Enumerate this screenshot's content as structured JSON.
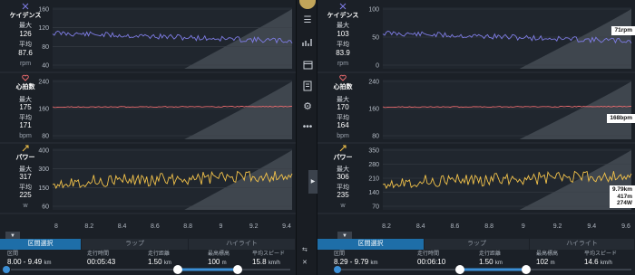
{
  "metrics": {
    "cadence": "ケイデンス",
    "heart_rate": "心拍数",
    "power": "パワー"
  },
  "stat_labels": {
    "max": "最大",
    "avg": "平均"
  },
  "units": {
    "rpm": "rpm",
    "bpm": "bpm",
    "w": "w"
  },
  "icons": {
    "cadence": "cadence-icon",
    "heart": "heart-icon",
    "power": "power-icon",
    "menu": "menu-icon",
    "graph": "graph-icon",
    "calendar": "calendar-icon",
    "file": "file-icon",
    "settings": "settings-icon",
    "more": "more-icon"
  },
  "colors": {
    "cadence": "#7f7de6",
    "heart": "#e86a6d",
    "power": "#f2c24a",
    "accent": "#1e6ea8",
    "track": "#3b8fd6"
  },
  "left": {
    "cadence": {
      "max": "126",
      "avg": "87.6",
      "ticks": [
        "160",
        "120",
        "80",
        "40"
      ]
    },
    "heart": {
      "max": "175",
      "avg": "171",
      "ticks": [
        "240",
        "160",
        "80"
      ]
    },
    "power": {
      "max": "317",
      "avg": "225",
      "ticks": [
        "400",
        "300",
        "150",
        "60"
      ]
    },
    "x_ticks": [
      "8",
      "8.2",
      "8.4",
      "8.6",
      "8.8",
      "9",
      "9.2",
      "9.4"
    ],
    "tabs": [
      "区間選択",
      "ラップ",
      "ハイライト"
    ],
    "stats": [
      {
        "label": "区間",
        "value": "8.00 - 9.49",
        "unit": "km"
      },
      {
        "label": "走行時間",
        "value": "00:05:43",
        "unit": ""
      },
      {
        "label": "走行距離",
        "value": "1.50",
        "unit": "km"
      },
      {
        "label": "最高標高",
        "value": "100",
        "unit": "m"
      },
      {
        "label": "平均スピード",
        "value": "15.8",
        "unit": "km/h"
      }
    ]
  },
  "right": {
    "cadence": {
      "max": "103",
      "avg": "83.9",
      "ticks": [
        "100",
        "50",
        "0"
      ],
      "tooltip": "71rpm"
    },
    "heart": {
      "max": "170",
      "avg": "164",
      "ticks": [
        "240",
        "160",
        "80"
      ],
      "tooltip": "168bpm"
    },
    "power": {
      "max": "306",
      "avg": "235",
      "ticks": [
        "350",
        "280",
        "210",
        "140",
        "70"
      ],
      "tooltip": [
        "9.79km",
        "417m",
        "274W"
      ]
    },
    "x_ticks": [
      "8.2",
      "8.4",
      "8.6",
      "8.8",
      "9",
      "9.2",
      "9.4",
      "9.6"
    ],
    "tabs": [
      "区間選択",
      "ラップ",
      "ハイライト"
    ],
    "stats": [
      {
        "label": "区間",
        "value": "8.29 - 9.79",
        "unit": "km"
      },
      {
        "label": "走行時間",
        "value": "00:06:10",
        "unit": ""
      },
      {
        "label": "走行距離",
        "value": "1.50",
        "unit": "km"
      },
      {
        "label": "最高標高",
        "value": "102",
        "unit": "m"
      },
      {
        "label": "平均スピード",
        "value": "14.6",
        "unit": "km/h"
      }
    ]
  }
}
